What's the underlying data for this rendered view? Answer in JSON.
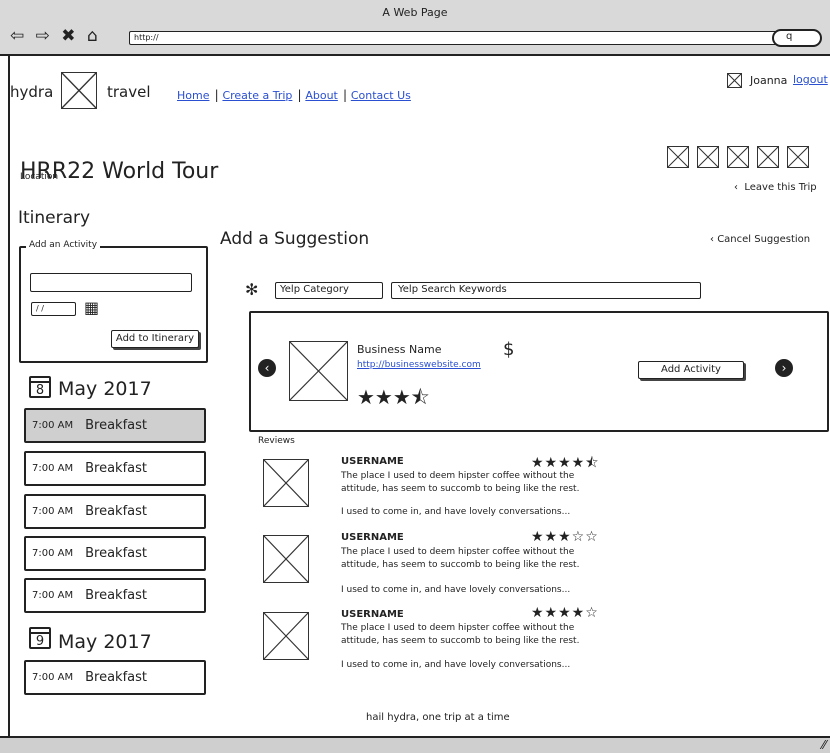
{
  "browser": {
    "title": "A Web Page",
    "url": "http://",
    "nav_icons": "⇦ ⇨ ✖ ⌂",
    "search_glyph": "q"
  },
  "header": {
    "brand_left": "hydra",
    "brand_right": "travel",
    "nav": [
      "Home",
      "Create a Trip",
      "About",
      "Contact Us"
    ],
    "user_name": "Joanna",
    "logout": "logout"
  },
  "trip": {
    "title": "HRR22 World Tour",
    "location": "Location",
    "leave": "Leave this Trip"
  },
  "itinerary": {
    "title": "Itinerary",
    "add_activity_legend": "Add an Activity",
    "date_placeholder": "/ /",
    "add_button": "Add to Itinerary",
    "days": [
      {
        "day_num": "8",
        "label": "May 2017",
        "items": [
          {
            "time": "7:00 AM",
            "event": "Breakfast"
          },
          {
            "time": "7:00 AM",
            "event": "Breakfast"
          },
          {
            "time": "7:00 AM",
            "event": "Breakfast"
          },
          {
            "time": "7:00 AM",
            "event": "Breakfast"
          },
          {
            "time": "7:00 AM",
            "event": "Breakfast"
          }
        ]
      },
      {
        "day_num": "9",
        "label": "May 2017",
        "items": [
          {
            "time": "7:00 AM",
            "event": "Breakfast"
          }
        ]
      }
    ]
  },
  "suggestion": {
    "title": "Add a Suggestion",
    "cancel": "Cancel Suggestion",
    "yelp_category": "Yelp Category",
    "yelp_keywords": "Yelp Search Keywords",
    "business_name": "Business Name",
    "business_url": "http://businesswebsite.com",
    "price": "$",
    "business_stars": "★★★⯪",
    "add_activity": "Add Activity",
    "reviews_label": "Reviews",
    "reviews": [
      {
        "username": "USERNAME",
        "stars": "★★★★⯪",
        "text1": "The place I used to deem hipster coffee without the",
        "text2": "attitude, has seem to succomb to being like the rest.",
        "text3": "I used to come in, and have lovely conversations..."
      },
      {
        "username": "USERNAME",
        "stars": "★★★☆☆",
        "text1": "The place I used to deem hipster coffee without the",
        "text2": "attitude, has seem to succomb to being like the rest.",
        "text3": "I used to come in, and have lovely conversations..."
      },
      {
        "username": "USERNAME",
        "stars": "★★★★☆",
        "text1": "The place I used to deem hipster coffee without the",
        "text2": "attitude, has seem to succomb to being like the rest.",
        "text3": "I used to come in, and have lovely conversations..."
      }
    ]
  },
  "footer": {
    "tagline": "hail hydra, one trip at a time"
  }
}
